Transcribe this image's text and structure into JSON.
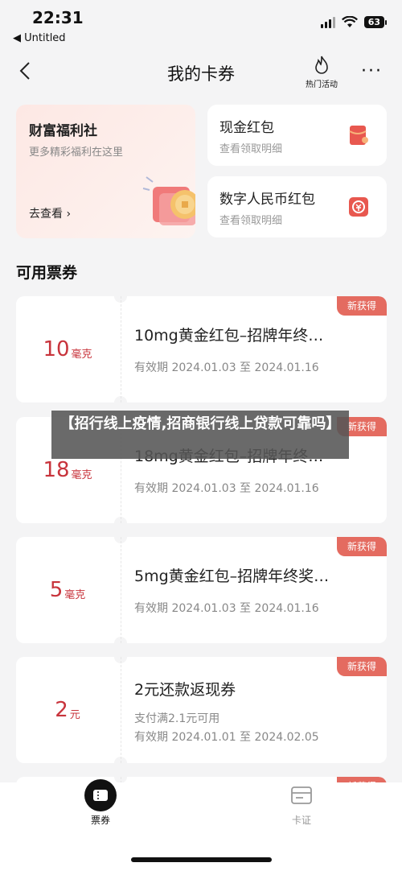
{
  "status": {
    "time": "22:31",
    "back_app": "◀ Untitled",
    "battery": "63"
  },
  "nav": {
    "title": "我的卡券",
    "hot_label": "热门活动",
    "more": "···"
  },
  "promos": {
    "left": {
      "title": "财富福利社",
      "subtitle": "更多精彩福利在这里",
      "cta": "去查看 ›"
    },
    "cash": {
      "title": "现金红包",
      "subtitle": "查看领取明细"
    },
    "digital": {
      "title": "数字人民币红包",
      "subtitle": "查看领取明细"
    }
  },
  "section": {
    "title": "可用票券"
  },
  "coupons": [
    {
      "amount": "10",
      "unit": "毫克",
      "name": "10mg黄金红包–招牌年终…",
      "lines": [
        "有效期 2024.01.03 至 2024.01.16"
      ],
      "badge": "新获得"
    },
    {
      "amount": "18",
      "unit": "毫克",
      "name": "18mg黄金红包–招牌年终…",
      "lines": [
        "有效期 2024.01.03 至 2024.01.16"
      ],
      "badge": "新获得"
    },
    {
      "amount": "5",
      "unit": "毫克",
      "name": "5mg黄金红包–招牌年终奖…",
      "lines": [
        "有效期 2024.01.03 至 2024.01.16"
      ],
      "badge": "新获得"
    },
    {
      "amount": "2",
      "unit": "元",
      "name": "2元还款返现券",
      "lines": [
        "支付满2.1元可用",
        "有效期 2024.01.01 至 2024.02.05"
      ],
      "badge": "新获得"
    },
    {
      "badge": "新获得"
    }
  ],
  "overlay": {
    "text": "【招行线上疫情,招商银行线上贷款可靠吗】"
  },
  "tabs": {
    "coupons": "票券",
    "cards": "卡证"
  },
  "colors": {
    "accent_red": "#c8343c",
    "badge": "#e46b60",
    "background": "#f4f4f5"
  }
}
